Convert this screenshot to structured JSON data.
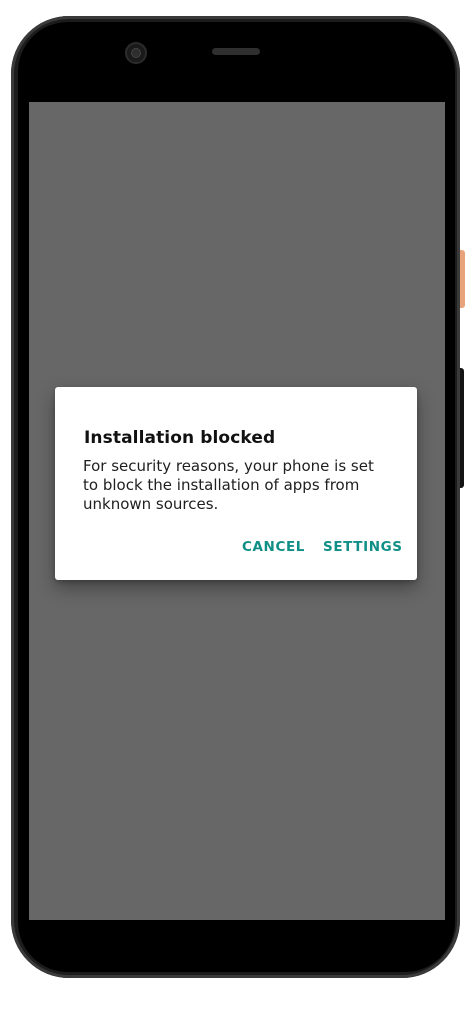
{
  "dialog": {
    "title": "Installation blocked",
    "message": "For security reasons, your phone is set to block the installation of apps from unknown sources.",
    "cancel_label": "CANCEL",
    "settings_label": "SETTINGS"
  },
  "colors": {
    "accent": "#0f8f86",
    "scrim": "#676767",
    "device_body": "#1c1c1c",
    "power_button": "#e8a27c"
  },
  "icons": {
    "camera": "front-camera-icon",
    "speaker": "earpiece-speaker-icon"
  }
}
